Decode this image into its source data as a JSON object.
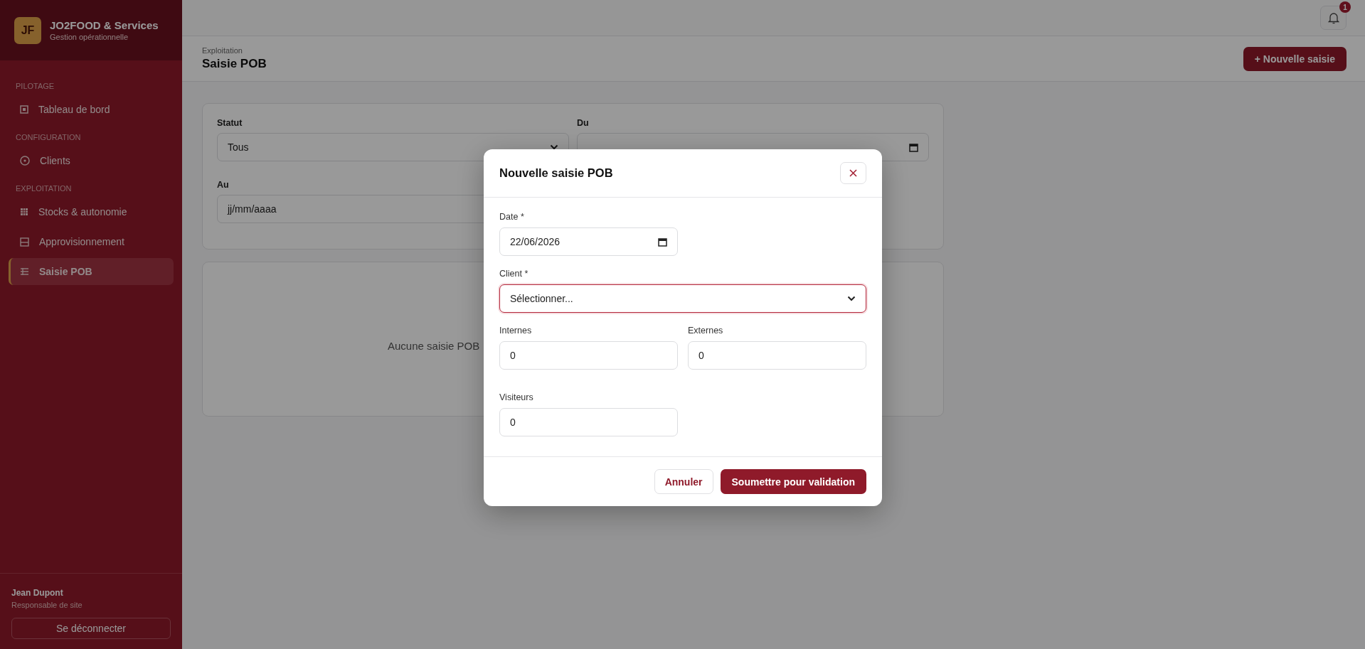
{
  "sidebar": {
    "logo": "JF",
    "brand": "JO2FOOD & Services",
    "subtitle": "Gestion opérationnelle",
    "sections": [
      {
        "title": "PILOTAGE",
        "items": [
          {
            "label": "Tableau de bord",
            "selected": false
          }
        ]
      },
      {
        "title": "CONFIGURATION",
        "items": [
          {
            "label": "Clients",
            "selected": false
          }
        ]
      },
      {
        "title": "EXPLOITATION",
        "items": [
          {
            "label": "Stocks & autonomie",
            "selected": false
          },
          {
            "label": "Approvisionnement",
            "selected": false
          },
          {
            "label": "Saisie POB",
            "selected": true
          }
        ]
      }
    ],
    "user": {
      "name": "Jean Dupont",
      "role": "Responsable de site"
    },
    "logout": "Se déconnecter"
  },
  "topbar": {
    "notification_count": "1"
  },
  "header": {
    "breadcrumb": "Exploitation",
    "title": "Saisie POB",
    "new_button": "+ Nouvelle saisie"
  },
  "filters": [
    {
      "label": "Statut",
      "kind": "select",
      "value": "Tous"
    },
    {
      "label": "Du",
      "kind": "date"
    },
    {
      "label": "Au",
      "kind": "date",
      "value": "jj/mm/aaaa"
    }
  ],
  "empty_message": "Aucune saisie POB",
  "modal": {
    "title": "Nouvelle saisie POB",
    "fields": [
      {
        "label": "Date *",
        "kind": "date",
        "value": "22/06/2026",
        "invalid": false
      },
      {
        "label": "Client *",
        "kind": "select",
        "value": "Sélectionner...",
        "invalid": true
      },
      {
        "label": "Internes",
        "kind": "number",
        "value": "0",
        "invalid": false
      },
      {
        "label": "Externes",
        "kind": "number",
        "value": "0",
        "invalid": false
      },
      {
        "label": "Visiteurs",
        "kind": "number",
        "value": "0",
        "invalid": false
      }
    ],
    "cancel": "Annuler",
    "submit": "Soumettre pour validation"
  }
}
